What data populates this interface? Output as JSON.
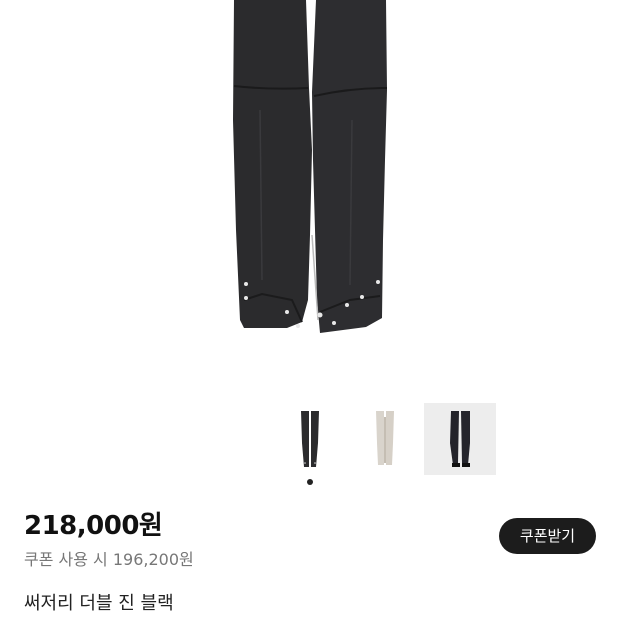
{
  "product": {
    "price": "218,000원",
    "coupon_price_text": "쿠폰 사용 시 196,200원",
    "coupon_button_label": "쿠폰받기",
    "name": "써저리 더블 진 블랙"
  },
  "gallery": {
    "main_image": "black-double-jeans-photo",
    "thumbnails": [
      {
        "image": "black-jeans-front-thumbnail",
        "selected": true
      },
      {
        "image": "ivory-jeans-thumbnail",
        "selected": false
      },
      {
        "image": "black-jeans-worn-thumbnail",
        "selected": false
      }
    ]
  },
  "colors": {
    "denim": "#2a2a2c",
    "button": "#1c1c1c",
    "thumb_bg": "#ededed"
  }
}
